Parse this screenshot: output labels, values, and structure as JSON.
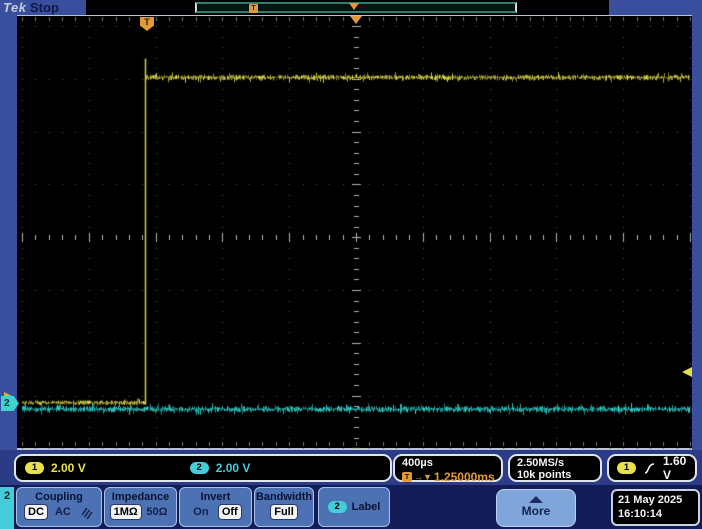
{
  "header": {
    "logo": "Tek",
    "acq_status": "Stop"
  },
  "display": {
    "trigger_flag_label": "T",
    "acq_bar_trigger_label": "T",
    "ch2_marker_label": "2"
  },
  "readouts": {
    "ch1_badge": "1",
    "ch1_scale": "2.00 V",
    "ch2_badge": "2",
    "ch2_scale": "2.00 V",
    "horizontal_scale": "400µs",
    "trigger_t_badge": "T",
    "delay_arrows": "→▼",
    "trigger_delay": "1.25000ms",
    "sample_rate": "2.50MS/s",
    "record_length": "10k points",
    "trigger_source_badge": "1",
    "trigger_level": "1.60 V"
  },
  "menu": {
    "channel_tab": "2",
    "coupling": {
      "title": "Coupling",
      "dc": "DC",
      "ac": "AC"
    },
    "impedance": {
      "title": "Impedance",
      "one_meg": "1MΩ",
      "fifty": "50Ω"
    },
    "invert": {
      "title": "Invert",
      "on": "On",
      "off": "Off"
    },
    "bandwidth": {
      "title": "Bandwidth",
      "value": "Full"
    },
    "label_button": {
      "channel_badge": "2",
      "text": "Label"
    },
    "more": {
      "text": "More"
    },
    "datetime": {
      "date": "21 May 2025",
      "time": "16:10:14"
    }
  },
  "colors": {
    "ch1_yellow": "#dcd84b",
    "ch2_cyan": "#2fd3cd",
    "trigger_orange": "#e09a38",
    "panel_blue": "#3a4e9e",
    "button_blue": "#4c72b4",
    "grid_dot": "#59655c",
    "grid_tick": "#aeb8ae",
    "edge_tick": "#6e786e"
  },
  "chart_data": {
    "type": "line",
    "title": "Oscilloscope acquisition (stopped)",
    "x_axis": {
      "scale_per_div": "400µs",
      "divisions": 10,
      "sample_rate": "2.50MS/s",
      "record_length": "10k points",
      "trigger_to_center_delay": "1.25000ms"
    },
    "y_axis": {
      "divisions": 8,
      "ch1_scale_per_div": "2.00 V",
      "ch2_scale_per_div": "2.00 V"
    },
    "series": [
      {
        "name": "CH1",
        "color": "#dcd84b",
        "shape": "step",
        "description": "Low (~0 V) noisy level until rising edge ~3.1 divisions left of screen center, then flat noisy high level ~6 divisions (~12 V) above low, to end of record",
        "low_level_V": 0,
        "high_level_V": 12,
        "edge_time_relative_to_center": "-1.25ms"
      },
      {
        "name": "CH2",
        "color": "#2fd3cd",
        "shape": "flat-noise",
        "description": "Flat noisy baseline (~0 V) across entire record",
        "level_V": 0
      }
    ],
    "trigger": {
      "source": "CH1",
      "slope": "rising",
      "level": "1.60 V"
    },
    "render": {
      "edge_x_frac": 0.19,
      "ch1_high_y_frac": 0.142,
      "ch1_low_y_frac": 0.893,
      "ch1_overshoot_top_frac": 0.098,
      "ch2_y_frac": 0.908,
      "plot": {
        "x0": 5,
        "y0": 10,
        "dx": 66.8,
        "dy": 52.8,
        "cols": 10,
        "rows": 8
      }
    }
  }
}
